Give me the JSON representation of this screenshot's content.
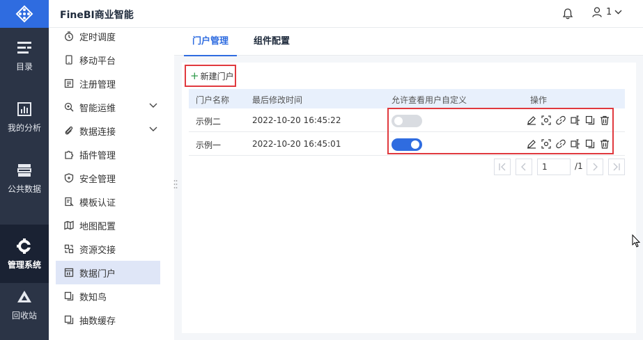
{
  "app": {
    "title": "FineBI商业智能",
    "user": "1"
  },
  "rail": {
    "items": [
      {
        "label": "目录",
        "icon": "catalog-icon"
      },
      {
        "label": "我的分析",
        "icon": "analysis-icon"
      },
      {
        "label": "公共数据",
        "icon": "public-data-icon"
      },
      {
        "label": "管理系统",
        "icon": "manage-gear-icon",
        "active": true
      },
      {
        "label": "回收站",
        "icon": "recycle-icon"
      }
    ]
  },
  "sidebar": {
    "items": [
      {
        "label": "定时调度",
        "icon": "timer-icon"
      },
      {
        "label": "移动平台",
        "icon": "mobile-icon"
      },
      {
        "label": "注册管理",
        "icon": "register-icon"
      },
      {
        "label": "智能运维",
        "icon": "ops-icon",
        "expandable": true
      },
      {
        "label": "数据连接",
        "icon": "link-icon",
        "expandable": true
      },
      {
        "label": "插件管理",
        "icon": "plugin-icon"
      },
      {
        "label": "安全管理",
        "icon": "shield-icon"
      },
      {
        "label": "模板认证",
        "icon": "template-icon"
      },
      {
        "label": "地图配置",
        "icon": "map-icon"
      },
      {
        "label": "资源交接",
        "icon": "resource-icon"
      },
      {
        "label": "数据门户",
        "icon": "portal-icon",
        "active": true
      },
      {
        "label": "数知鸟",
        "icon": "copy-icon"
      },
      {
        "label": "抽数缓存",
        "icon": "copy-icon"
      }
    ]
  },
  "tabs": [
    {
      "label": "门户管理",
      "active": true
    },
    {
      "label": "组件配置",
      "active": false
    }
  ],
  "toolbar": {
    "new_portal": "新建门户"
  },
  "table": {
    "columns": [
      "门户名称",
      "最后修改时间",
      "允许查看用户自定义",
      "操作"
    ],
    "rows": [
      {
        "name": "示例二",
        "modified": "2022-10-20 16:45:22",
        "allow_custom": false
      },
      {
        "name": "示例一",
        "modified": "2022-10-20 16:45:01",
        "allow_custom": true
      }
    ],
    "actions": [
      "edit-icon",
      "preview-icon",
      "link-icon",
      "move-icon",
      "copy-icon",
      "delete-icon"
    ]
  },
  "pagination": {
    "current": "1",
    "total": "/1"
  },
  "colors": {
    "accent": "#2f6ce0",
    "rail_bg": "#2b3446",
    "highlight": "#e0393e",
    "toggle_off": "#d9dce1"
  }
}
